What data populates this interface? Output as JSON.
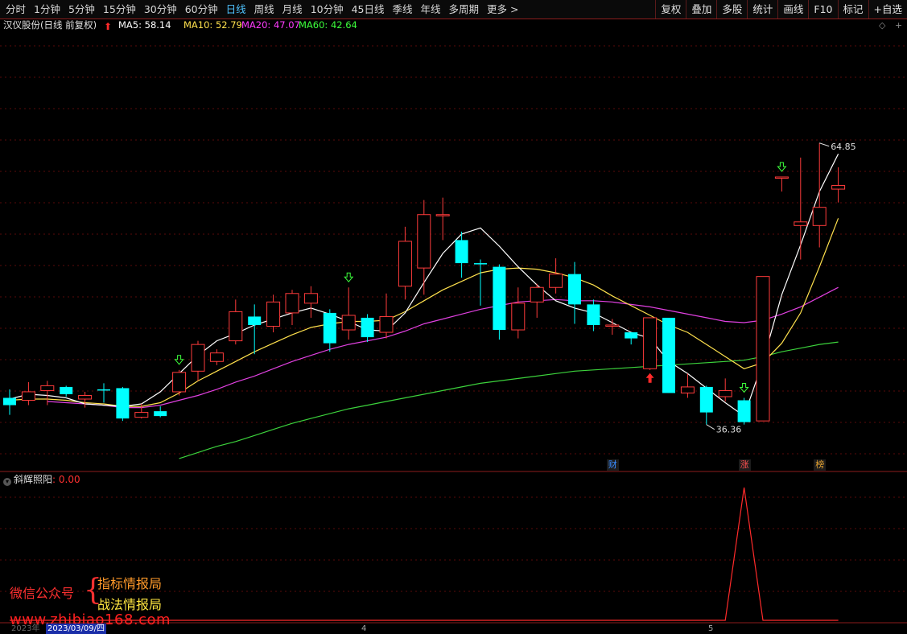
{
  "toolbar": {
    "periods": [
      "分时",
      "1分钟",
      "5分钟",
      "15分钟",
      "30分钟",
      "60分钟",
      "日线",
      "周线",
      "月线",
      "10分钟",
      "45日线",
      "季线",
      "年线",
      "多周期",
      "更多 >"
    ],
    "active_period": "日线",
    "right_buttons": [
      "复权",
      "叠加",
      "多股",
      "统计",
      "画线",
      "F10",
      "标记",
      "+自选"
    ]
  },
  "info": {
    "stock_title": "汉仪股份(日线 前复权)",
    "ma": [
      {
        "label": "MA5: 58.14",
        "color": "#ffffff"
      },
      {
        "label": "MA10: 52.79",
        "color": "#ffe14d"
      },
      {
        "label": "MA20: 47.07",
        "color": "#ff3cff"
      },
      {
        "label": "MA60: 42.64",
        "color": "#3cff3c"
      }
    ],
    "ctrl_diamond": "◇",
    "ctrl_plus": "+"
  },
  "colors": {
    "up": "#ff3b3b",
    "down": "#00ffff",
    "ma5": "#ffffff",
    "ma10": "#ffe14d",
    "ma20": "#e040e0",
    "ma60": "#3cd23c",
    "grid": "#5a0a0a",
    "indicator": "#ff2a2a"
  },
  "chart_data": {
    "type": "candlestick",
    "y_range": [
      32,
      68
    ],
    "x": [
      1,
      2,
      3,
      4,
      5,
      6,
      7,
      8,
      9,
      10,
      11,
      12,
      13,
      14,
      15,
      16,
      17,
      18,
      19,
      20,
      21,
      22,
      23,
      24,
      25,
      26,
      27,
      28,
      29,
      30,
      31,
      32,
      33,
      34,
      35,
      36,
      37,
      38,
      39,
      40,
      41,
      42,
      43,
      44,
      45
    ],
    "candles": [
      [
        38.0,
        37.4,
        36.6,
        38.7
      ],
      [
        37.8,
        38.5,
        37.4,
        39.3
      ],
      [
        38.6,
        39.0,
        37.4,
        39.4
      ],
      [
        38.9,
        38.3,
        38.1,
        39.0
      ],
      [
        37.9,
        38.2,
        37.2,
        38.5
      ],
      [
        38.7,
        38.6,
        37.6,
        39.2
      ],
      [
        38.8,
        36.3,
        36.1,
        38.9
      ],
      [
        36.4,
        36.8,
        36.3,
        37.5
      ],
      [
        36.9,
        36.5,
        36.4,
        37.3
      ],
      [
        38.5,
        40.1,
        38.2,
        40.3
      ],
      [
        40.2,
        42.4,
        39.4,
        42.7
      ],
      [
        41.0,
        41.7,
        40.7,
        42.0
      ],
      [
        42.7,
        45.1,
        42.4,
        46.1
      ],
      [
        44.7,
        44.0,
        41.6,
        45.7
      ],
      [
        43.9,
        45.9,
        43.4,
        46.5
      ],
      [
        45.0,
        46.6,
        44.0,
        46.9
      ],
      [
        45.8,
        46.6,
        44.6,
        47.2
      ],
      [
        45.0,
        42.5,
        41.8,
        45.3
      ],
      [
        43.6,
        44.8,
        42.8,
        47.1
      ],
      [
        44.6,
        43.0,
        42.6,
        44.9
      ],
      [
        43.4,
        44.7,
        42.9,
        46.6
      ],
      [
        47.2,
        50.9,
        46.1,
        52.1
      ],
      [
        48.7,
        53.1,
        46.5,
        54.3
      ],
      [
        53.1,
        53.1,
        51.0,
        54.5
      ],
      [
        51.0,
        49.1,
        47.9,
        51.7
      ],
      [
        49.1,
        49.0,
        45.6,
        49.4
      ],
      [
        48.8,
        43.6,
        42.8,
        49.0
      ],
      [
        43.6,
        45.8,
        42.9,
        47.1
      ],
      [
        45.9,
        47.1,
        44.6,
        47.4
      ],
      [
        47.1,
        48.2,
        46.6,
        49.5
      ],
      [
        48.2,
        45.7,
        44.1,
        49.2
      ],
      [
        45.7,
        44.0,
        43.5,
        46.1
      ],
      [
        44.0,
        44.0,
        43.2,
        44.5
      ],
      [
        43.4,
        42.9,
        42.4,
        43.4
      ],
      [
        40.4,
        44.6,
        40.3,
        44.6
      ],
      [
        44.6,
        38.4,
        38.4,
        44.6
      ],
      [
        38.4,
        38.9,
        38.0,
        40.0
      ],
      [
        38.9,
        36.8,
        35.8,
        39.0
      ],
      [
        38.1,
        38.6,
        37.7,
        39.6
      ],
      [
        37.8,
        36.0,
        35.8,
        38.0
      ],
      [
        36.1,
        48.0,
        36.1,
        48.0
      ],
      [
        56.2,
        56.2,
        55.0,
        56.2
      ],
      [
        52.2,
        52.5,
        49.4,
        57.8
      ],
      [
        52.2,
        53.7,
        50.4,
        59.0
      ],
      [
        55.2,
        55.5,
        54.1,
        57.0
      ]
    ],
    "ma5": [
      37.9,
      38.3,
      38.2,
      38.0,
      37.5,
      37.4,
      37.3,
      37.5,
      38.5,
      40.0,
      41.5,
      42.7,
      43.3,
      44.0,
      44.5,
      45.0,
      45.4,
      44.9,
      44.3,
      43.6,
      43.5,
      45.0,
      47.5,
      49.9,
      51.5,
      52.0,
      50.5,
      48.8,
      47.3,
      46.0,
      45.4,
      45.0,
      44.2,
      43.4,
      42.9,
      41.0,
      40.0,
      38.8,
      37.6,
      36.5,
      41.0,
      46.5,
      50.6,
      55.0,
      58.1
    ],
    "ma10": [
      37.8,
      37.9,
      37.9,
      37.8,
      37.6,
      37.5,
      37.3,
      37.3,
      37.6,
      38.4,
      39.4,
      40.2,
      41.0,
      41.8,
      42.5,
      43.2,
      43.8,
      44.1,
      44.3,
      44.3,
      44.4,
      45.1,
      46.0,
      46.9,
      47.6,
      48.3,
      48.6,
      48.7,
      48.6,
      48.3,
      47.9,
      47.3,
      46.4,
      45.6,
      44.8,
      44.0,
      43.4,
      42.4,
      41.4,
      40.4,
      40.9,
      42.5,
      45.0,
      48.8,
      52.8
    ],
    "ma20": [
      null,
      null,
      37.7,
      37.6,
      37.5,
      37.4,
      37.2,
      37.2,
      37.4,
      37.8,
      38.2,
      38.7,
      39.3,
      39.8,
      40.4,
      41.0,
      41.5,
      42.0,
      42.4,
      42.7,
      43.0,
      43.5,
      44.1,
      44.5,
      44.9,
      45.3,
      45.6,
      45.9,
      46.0,
      46.1,
      46.0,
      46.0,
      45.9,
      45.7,
      45.5,
      45.2,
      44.9,
      44.6,
      44.3,
      44.2,
      44.4,
      44.9,
      45.5,
      46.3,
      47.1
    ],
    "ma60": [
      null,
      null,
      null,
      null,
      null,
      null,
      null,
      null,
      null,
      33.0,
      33.5,
      34.0,
      34.4,
      34.9,
      35.4,
      35.9,
      36.3,
      36.7,
      37.1,
      37.4,
      37.7,
      38.0,
      38.3,
      38.6,
      38.9,
      39.2,
      39.4,
      39.6,
      39.8,
      40.0,
      40.2,
      40.3,
      40.4,
      40.5,
      40.6,
      40.7,
      40.8,
      40.9,
      41.0,
      41.1,
      41.4,
      41.8,
      42.1,
      42.4,
      42.6
    ],
    "annotations": {
      "high": "64.85",
      "low": "36.36"
    },
    "signals_green": [
      10,
      19,
      40,
      42
    ],
    "signal_red": 35,
    "labels_bottom": [
      {
        "x": 33,
        "text": "财",
        "color": "#3a8cff"
      },
      {
        "x": 40,
        "text": "涨",
        "color": "#ff5050"
      },
      {
        "x": 44,
        "text": "榜",
        "color": "#e0a030"
      }
    ],
    "indicator": {
      "name": "斜辉照阳",
      "value": ": 0.00",
      "values": [
        0,
        0,
        0,
        0,
        0,
        0,
        0,
        0,
        0,
        0,
        0,
        0,
        0,
        0,
        0,
        0,
        0,
        0,
        0,
        0,
        0,
        0,
        0,
        0,
        0,
        0,
        0,
        0,
        0,
        0,
        0,
        0,
        0,
        0,
        0,
        0,
        0,
        0,
        0,
        1,
        0,
        0,
        0,
        0,
        0
      ],
      "y_range": [
        0,
        1
      ]
    }
  },
  "watermark": {
    "line1": "微信公众号",
    "brace": "{",
    "line2": "指标情报局",
    "line3": "战法情报局",
    "url": "www.zhibiao168.com"
  },
  "datebar": {
    "year": "2023年",
    "date": "2023/03/09/四",
    "month4": "4",
    "month5": "5"
  }
}
